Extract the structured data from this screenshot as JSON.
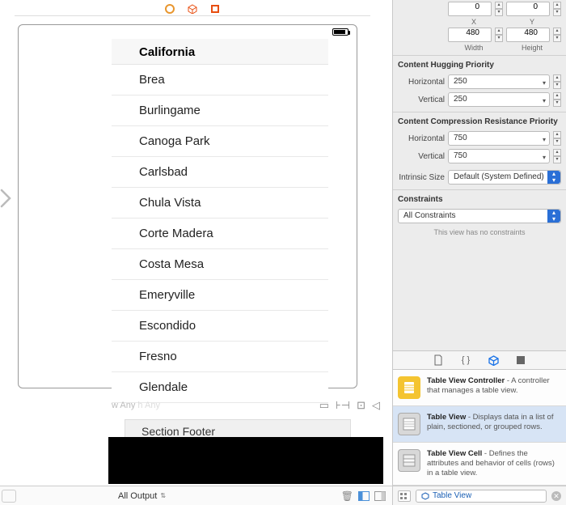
{
  "canvas": {
    "section_header": "California",
    "rows": [
      "Brea",
      "Burlingame",
      "Canoga Park",
      "Carlsbad",
      "Chula Vista",
      "Corte Madera",
      "Costa Mesa",
      "Emeryville",
      "Escondido",
      "Fresno",
      "Glendale"
    ],
    "section_footer_label": "Section Footer",
    "any_label_w": "w Any",
    "any_label_h": "h Any"
  },
  "bottom": {
    "all_output": "All Output"
  },
  "inspector": {
    "position": {
      "x": "0",
      "y": "0",
      "x_label": "X",
      "y_label": "Y"
    },
    "size": {
      "width": "480",
      "height": "480",
      "w_label": "Width",
      "h_label": "Height"
    },
    "hugging": {
      "title": "Content Hugging Priority",
      "horizontal_label": "Horizontal",
      "horizontal_value": "250",
      "vertical_label": "Vertical",
      "vertical_value": "250"
    },
    "compression": {
      "title": "Content Compression Resistance Priority",
      "horizontal_label": "Horizontal",
      "horizontal_value": "750",
      "vertical_label": "Vertical",
      "vertical_value": "750"
    },
    "intrinsic": {
      "label": "Intrinsic Size",
      "value": "Default (System Defined)"
    },
    "constraints": {
      "title": "Constraints",
      "value": "All Constraints",
      "note": "This view has no constraints"
    }
  },
  "library": {
    "items": [
      {
        "icon": "tvc",
        "title": "Table View Controller",
        "desc": " - A controller that manages a table view."
      },
      {
        "icon": "tv",
        "title": "Table View",
        "desc": " - Displays data in a list of plain, sectioned, or grouped rows."
      },
      {
        "icon": "tvcell",
        "title": "Table View Cell",
        "desc": " - Defines the attributes and behavior of cells (rows) in a table view."
      }
    ],
    "search_value": "Table View"
  }
}
